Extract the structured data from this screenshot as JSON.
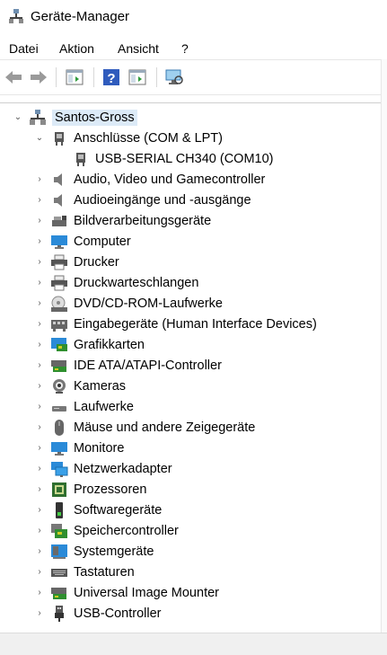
{
  "window": {
    "title": "Geräte-Manager"
  },
  "menu": [
    "Datei",
    "Aktion",
    "Ansicht",
    "?"
  ],
  "toolbar": {
    "buttons": [
      {
        "name": "back-icon"
      },
      {
        "name": "forward-icon"
      },
      {
        "name": "properties-icon"
      },
      {
        "name": "help-icon"
      },
      {
        "name": "update-driver-icon"
      },
      {
        "name": "scan-hardware-icon"
      }
    ]
  },
  "tree": {
    "root": {
      "label": "Santos-Gross",
      "expanded": true
    },
    "nodes": [
      {
        "label": "Anschlüsse (COM & LPT)",
        "expanded": true,
        "icon": "port-icon",
        "children": [
          {
            "label": "USB-SERIAL CH340 (COM10)",
            "icon": "port-icon"
          }
        ]
      },
      {
        "label": "Audio, Video und Gamecontroller",
        "icon": "speaker-icon"
      },
      {
        "label": "Audioeingänge und -ausgänge",
        "icon": "speaker-icon"
      },
      {
        "label": "Bildverarbeitungsgeräte",
        "icon": "imaging-device-icon"
      },
      {
        "label": "Computer",
        "icon": "computer-icon"
      },
      {
        "label": "Drucker",
        "icon": "printer-icon"
      },
      {
        "label": "Druckwarteschlangen",
        "icon": "printer-icon"
      },
      {
        "label": "DVD/CD-ROM-Laufwerke",
        "icon": "dvd-drive-icon"
      },
      {
        "label": "Eingabegeräte (Human Interface Devices)",
        "icon": "hid-icon"
      },
      {
        "label": "Grafikkarten",
        "icon": "display-adapter-icon"
      },
      {
        "label": "IDE ATA/ATAPI-Controller",
        "icon": "ide-controller-icon"
      },
      {
        "label": "Kameras",
        "icon": "camera-icon"
      },
      {
        "label": "Laufwerke",
        "icon": "disk-drive-icon"
      },
      {
        "label": "Mäuse und andere Zeigegeräte",
        "icon": "mouse-icon"
      },
      {
        "label": "Monitore",
        "icon": "monitor-icon"
      },
      {
        "label": "Netzwerkadapter",
        "icon": "network-adapter-icon"
      },
      {
        "label": "Prozessoren",
        "icon": "processor-icon"
      },
      {
        "label": "Softwaregeräte",
        "icon": "software-device-icon"
      },
      {
        "label": "Speichercontroller",
        "icon": "storage-controller-icon"
      },
      {
        "label": "Systemgeräte",
        "icon": "system-device-icon"
      },
      {
        "label": "Tastaturen",
        "icon": "keyboard-icon"
      },
      {
        "label": "Universal Image Mounter",
        "icon": "image-mounter-icon"
      },
      {
        "label": "USB-Controller",
        "icon": "usb-icon"
      }
    ]
  }
}
